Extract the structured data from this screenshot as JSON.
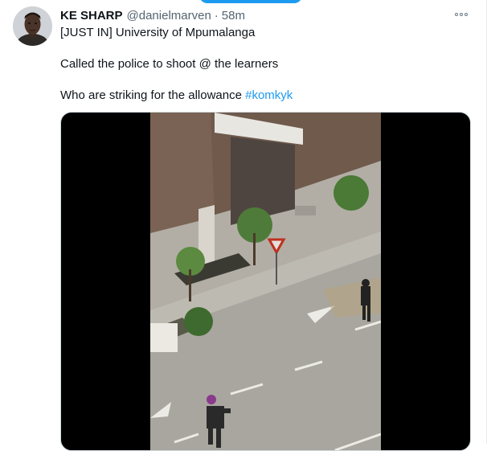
{
  "tweet": {
    "display_name": "KE SHARP",
    "handle": "@danielmarven",
    "separator": "·",
    "time": "58m",
    "line1": "[JUST IN] University of Mpumalanga",
    "line2": "Called the police to shoot @ the learners",
    "line3_text": "Who are striking for the allowance",
    "hashtag": "#komkyk"
  },
  "icons": {
    "more": "more-horizontal-icon",
    "avatar": "user-avatar"
  },
  "colors": {
    "accent": "#1d9bf0",
    "text": "#0f1419",
    "secondary": "#536471",
    "border": "#cfd9de"
  }
}
